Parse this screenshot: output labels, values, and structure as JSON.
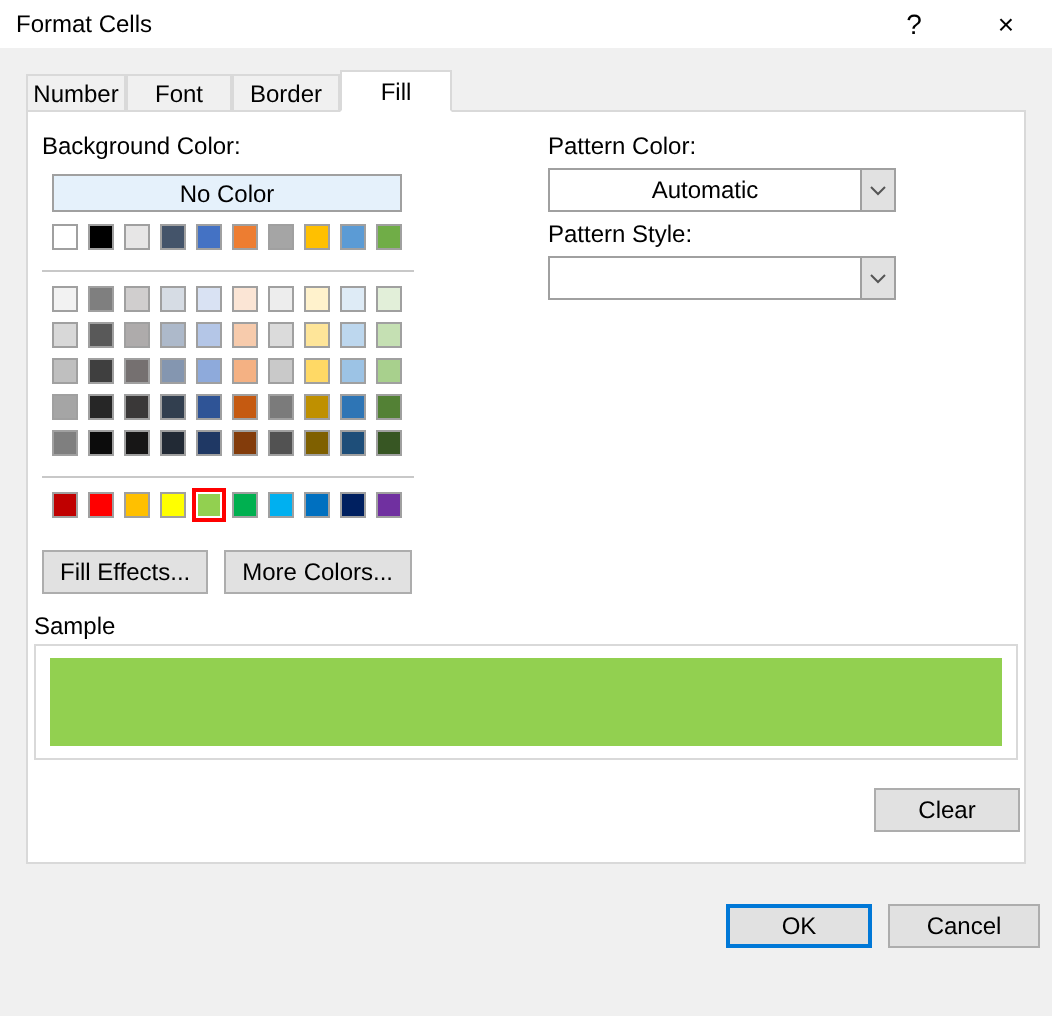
{
  "window": {
    "title": "Format Cells",
    "help": "?",
    "close": "×"
  },
  "tabs": [
    {
      "label": "Number",
      "selected": false
    },
    {
      "label": "Font",
      "selected": false
    },
    {
      "label": "Border",
      "selected": false
    },
    {
      "label": "Fill",
      "selected": true
    }
  ],
  "background_color": {
    "label": "Background Color:",
    "no_color_button": "No Color",
    "palette_rows": [
      {
        "kind": "theme",
        "swatches": [
          {
            "color": "#ffffff",
            "selected": false
          },
          {
            "color": "#000000",
            "selected": false
          },
          {
            "color": "#e7e6e6",
            "selected": false
          },
          {
            "color": "#44546a",
            "selected": false
          },
          {
            "color": "#4472c4",
            "selected": false
          },
          {
            "color": "#ed7d31",
            "selected": false
          },
          {
            "color": "#a5a5a5",
            "selected": false
          },
          {
            "color": "#ffc000",
            "selected": false
          },
          {
            "color": "#5b9bd5",
            "selected": false
          },
          {
            "color": "#70ad47",
            "selected": false
          }
        ]
      },
      {
        "kind": "tint",
        "swatches": [
          {
            "color": "#f2f2f2",
            "selected": false
          },
          {
            "color": "#7f7f7f",
            "selected": false
          },
          {
            "color": "#d0cece",
            "selected": false
          },
          {
            "color": "#d6dce4",
            "selected": false
          },
          {
            "color": "#d9e2f3",
            "selected": false
          },
          {
            "color": "#fbe5d5",
            "selected": false
          },
          {
            "color": "#ededed",
            "selected": false
          },
          {
            "color": "#fff2cc",
            "selected": false
          },
          {
            "color": "#deebf6",
            "selected": false
          },
          {
            "color": "#e2efd9",
            "selected": false
          }
        ]
      },
      {
        "kind": "tint",
        "swatches": [
          {
            "color": "#d8d8d8",
            "selected": false
          },
          {
            "color": "#595959",
            "selected": false
          },
          {
            "color": "#aeabab",
            "selected": false
          },
          {
            "color": "#adb9ca",
            "selected": false
          },
          {
            "color": "#b4c6e7",
            "selected": false
          },
          {
            "color": "#f7cbac",
            "selected": false
          },
          {
            "color": "#dbdbdb",
            "selected": false
          },
          {
            "color": "#fee599",
            "selected": false
          },
          {
            "color": "#bdd7ee",
            "selected": false
          },
          {
            "color": "#c5e0b3",
            "selected": false
          }
        ]
      },
      {
        "kind": "tint",
        "swatches": [
          {
            "color": "#bfbfbf",
            "selected": false
          },
          {
            "color": "#3f3f3f",
            "selected": false
          },
          {
            "color": "#757070",
            "selected": false
          },
          {
            "color": "#8496b0",
            "selected": false
          },
          {
            "color": "#8eaadb",
            "selected": false
          },
          {
            "color": "#f4b183",
            "selected": false
          },
          {
            "color": "#c9c9c9",
            "selected": false
          },
          {
            "color": "#ffd965",
            "selected": false
          },
          {
            "color": "#9cc3e5",
            "selected": false
          },
          {
            "color": "#a8d08d",
            "selected": false
          }
        ]
      },
      {
        "kind": "tint",
        "swatches": [
          {
            "color": "#a5a5a5",
            "selected": false
          },
          {
            "color": "#262626",
            "selected": false
          },
          {
            "color": "#3a3838",
            "selected": false
          },
          {
            "color": "#323f4f",
            "selected": false
          },
          {
            "color": "#2f5496",
            "selected": false
          },
          {
            "color": "#c55a11",
            "selected": false
          },
          {
            "color": "#7b7b7b",
            "selected": false
          },
          {
            "color": "#bf9000",
            "selected": false
          },
          {
            "color": "#2e75b5",
            "selected": false
          },
          {
            "color": "#538135",
            "selected": false
          }
        ]
      },
      {
        "kind": "tint",
        "swatches": [
          {
            "color": "#7f7f7f",
            "selected": false
          },
          {
            "color": "#0c0c0c",
            "selected": false
          },
          {
            "color": "#171616",
            "selected": false
          },
          {
            "color": "#222a35",
            "selected": false
          },
          {
            "color": "#1f3864",
            "selected": false
          },
          {
            "color": "#833c0b",
            "selected": false
          },
          {
            "color": "#525252",
            "selected": false
          },
          {
            "color": "#7f6000",
            "selected": false
          },
          {
            "color": "#1e4e79",
            "selected": false
          },
          {
            "color": "#375623",
            "selected": false
          }
        ]
      },
      {
        "kind": "standard",
        "swatches": [
          {
            "color": "#c00000",
            "selected": false
          },
          {
            "color": "#ff0000",
            "selected": false
          },
          {
            "color": "#ffc000",
            "selected": false
          },
          {
            "color": "#ffff00",
            "selected": false
          },
          {
            "color": "#92d050",
            "selected": true
          },
          {
            "color": "#00b050",
            "selected": false
          },
          {
            "color": "#00b0f0",
            "selected": false
          },
          {
            "color": "#0070c0",
            "selected": false
          },
          {
            "color": "#002060",
            "selected": false
          },
          {
            "color": "#7030a0",
            "selected": false
          }
        ]
      }
    ],
    "buttons": [
      "Fill Effects...",
      "More Colors..."
    ]
  },
  "pattern_color": {
    "label": "Pattern Color:",
    "value": "Automatic"
  },
  "pattern_style": {
    "label": "Pattern Style:"
  },
  "sample": {
    "label": "Sample",
    "color": "#92d050"
  },
  "clear_button": "Clear",
  "buttons": [
    "OK",
    "Cancel"
  ]
}
